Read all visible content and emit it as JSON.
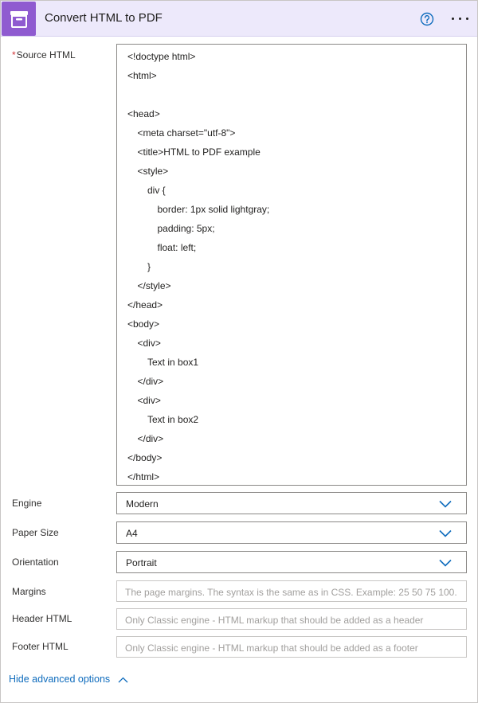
{
  "header": {
    "title": "Convert HTML to PDF",
    "accent": "#8f5bd0",
    "app_icon": "archive-box-icon",
    "help_icon": "question-circle-icon",
    "more_icon": "more-ellipsis-icon"
  },
  "source_html": {
    "label": "Source HTML",
    "required_mark": "*",
    "lines": [
      "<!doctype html>",
      "<html>",
      "",
      "<head>",
      "<meta charset=\"utf-8\">",
      "<title>HTML to PDF example",
      "<style>",
      "div {",
      "border: 1px solid lightgray;",
      "padding: 5px;",
      "float: left;",
      "}",
      "</style>",
      "</head>",
      "<body>",
      "<div>",
      "Text in box1",
      "</div>",
      "<div>",
      "Text in box2",
      "</div>",
      "</body>",
      "</html>"
    ],
    "indent_levels": [
      0,
      0,
      0,
      0,
      1,
      1,
      1,
      2,
      3,
      3,
      3,
      2,
      1,
      0,
      0,
      1,
      2,
      1,
      1,
      2,
      1,
      0,
      0
    ]
  },
  "engine": {
    "label": "Engine",
    "value": "Modern"
  },
  "paper_size": {
    "label": "Paper Size",
    "value": "A4"
  },
  "orientation": {
    "label": "Orientation",
    "value": "Portrait"
  },
  "margins": {
    "label": "Margins",
    "placeholder": "The page margins. The syntax is the same as in CSS. Example: 25 50 75 100."
  },
  "header_html": {
    "label": "Header HTML",
    "placeholder": "Only Classic engine - HTML markup that should be added as a header"
  },
  "footer_html": {
    "label": "Footer HTML",
    "placeholder": "Only Classic engine - HTML markup that should be added as a footer"
  },
  "advanced_toggle": {
    "label": "Hide advanced options",
    "icon": "chevron-up-icon"
  }
}
